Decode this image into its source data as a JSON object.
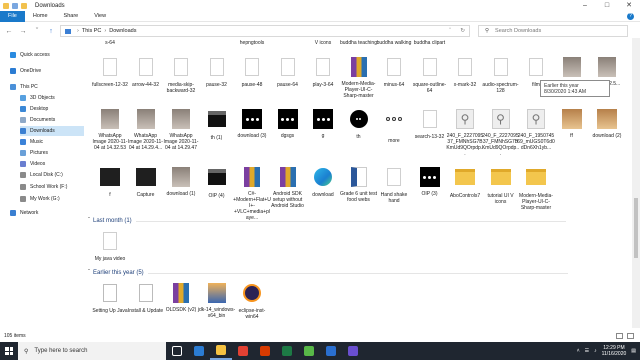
{
  "window": {
    "title": "Downloads"
  },
  "ribbon": {
    "tabs": [
      "File",
      "Home",
      "Share",
      "View"
    ]
  },
  "address": {
    "path": [
      "This PC",
      "Downloads"
    ],
    "search_placeholder": "Search Downloads"
  },
  "sidebar": {
    "items": [
      {
        "label": "Quick access",
        "color": "#2a8be0"
      },
      {
        "label": "OneDrive",
        "color": "#2b7cd3"
      },
      {
        "label": "This PC",
        "color": "#4a90d9"
      },
      {
        "label": "3D Objects",
        "color": "#57a0e0"
      },
      {
        "label": "Desktop",
        "color": "#3b88d6"
      },
      {
        "label": "Documents",
        "color": "#8ea9c8"
      },
      {
        "label": "Downloads",
        "color": "#3a7fd1"
      },
      {
        "label": "Music",
        "color": "#3a82d8"
      },
      {
        "label": "Pictures",
        "color": "#6aa0d8"
      },
      {
        "label": "Videos",
        "color": "#6a7ed0"
      },
      {
        "label": "Local Disk (C:)",
        "color": "#8a8a8a"
      },
      {
        "label": "School Work (F:)",
        "color": "#8a8a8a"
      },
      {
        "label": "My Work (G:)",
        "color": "#8a8a8a"
      },
      {
        "label": "Network",
        "color": "#3a7fd1"
      }
    ],
    "selected": "Downloads"
  },
  "files_top_partial": [
    {
      "label": "s-64"
    },
    {
      "label": ""
    },
    {
      "label": ""
    },
    {
      "label": ""
    },
    {
      "label": "hepngtools"
    },
    {
      "label": ""
    },
    {
      "label": "V icons"
    },
    {
      "label": "buddha teaching"
    },
    {
      "label": "buddha walking"
    },
    {
      "label": "buddha clipart"
    }
  ],
  "files_row1": [
    {
      "label": "fullscreen-12-32",
      "kind": "blank"
    },
    {
      "label": "arrow-44-32",
      "kind": "blank"
    },
    {
      "label": "media-skip-backward-32",
      "kind": "blank"
    },
    {
      "label": "pause-32",
      "kind": "blank"
    },
    {
      "label": "pause-48",
      "kind": "blank"
    },
    {
      "label": "pause-64",
      "kind": "blank"
    },
    {
      "label": "play-3-64",
      "kind": "blank"
    },
    {
      "label": "Modern-Media-Player-UI-C-Sharp-master",
      "kind": "rar"
    },
    {
      "label": "minus-64",
      "kind": "blank"
    },
    {
      "label": "square-outline-64",
      "kind": "blank"
    },
    {
      "label": "x-mark-32",
      "kind": "blank"
    },
    {
      "label": "audio-spectrum-128",
      "kind": "blank"
    },
    {
      "label": "film",
      "kind": "blank"
    },
    {
      "label": "",
      "kind": "photo"
    },
    {
      "label": "at 14.32.5...",
      "kind": "photo"
    }
  ],
  "files_row2": [
    {
      "label": "WhatsApp Image 2020-11-04 at 14.32.53",
      "kind": "photo"
    },
    {
      "label": "WhatsApp Image 2020-11-04 at 14.29.4...",
      "kind": "photo"
    },
    {
      "label": "WhatsApp Image 2020-11-04 at 14.29.47",
      "kind": "photo"
    },
    {
      "label": "th (1)",
      "kind": "clap"
    },
    {
      "label": "download (3)",
      "kind": "dots"
    },
    {
      "label": "dgsgs",
      "kind": "dots"
    },
    {
      "label": "g",
      "kind": "dots"
    },
    {
      "label": "th",
      "kind": "dots2"
    },
    {
      "label": "more",
      "kind": "more"
    },
    {
      "label": "search-13-32",
      "kind": "blank"
    },
    {
      "label": "240_F_222709537_FMNhSG7BKmUd9QOrpdp...",
      "kind": "search"
    },
    {
      "label": "240_F_222709537_FMNhSG7BKmUd9QOrpdp...",
      "kind": "search"
    },
    {
      "label": "240_F_195074569_mUGS0T6d0dDn6Xh1yb...",
      "kind": "search"
    },
    {
      "label": "ff",
      "kind": "cat"
    },
    {
      "label": "download (2)",
      "kind": "cat"
    }
  ],
  "files_row3": [
    {
      "label": "f",
      "kind": "dark"
    },
    {
      "label": "Capture",
      "kind": "dark"
    },
    {
      "label": "download (1)",
      "kind": "photo"
    },
    {
      "label": "OIP (4)",
      "kind": "clap"
    },
    {
      "label": "C#-+Modern+Flat+UI+-+VLC+media+playe...",
      "kind": "rar"
    },
    {
      "label": "Android SDK setup without Android Studio",
      "kind": "rar"
    },
    {
      "label": "download",
      "kind": "edge"
    },
    {
      "label": "Grade 6 unit test food webs",
      "kind": "word"
    },
    {
      "label": "Hand shake hand",
      "kind": "blank"
    },
    {
      "label": "OIP (3)",
      "kind": "dots"
    },
    {
      "label": "AboControls7",
      "kind": "folder"
    },
    {
      "label": "tutorial UI V icons",
      "kind": "folder"
    },
    {
      "label": "Modern-Media-Player-UI-C-Sharp-master",
      "kind": "folder"
    }
  ],
  "groups": {
    "last_month": "Last month (1)",
    "earlier_this_year": "Earlier this year (5)"
  },
  "files_last_month": [
    {
      "label": "My java video",
      "kind": "blank"
    }
  ],
  "files_earlier": [
    {
      "label": "Setting Up Java",
      "kind": "doc"
    },
    {
      "label": "Install & Update",
      "kind": "doc"
    },
    {
      "label": "OLDSDK (v2)",
      "kind": "rar"
    },
    {
      "label": "jdk-14_windows-x64_bin",
      "kind": "java"
    },
    {
      "label": "eclipse-inst-win64",
      "kind": "eclipse"
    }
  ],
  "tooltip": {
    "line1": "Earlier this year",
    "line2": "8/30/2020 1:43 AM"
  },
  "status": {
    "count": "105 items"
  },
  "taskbar": {
    "search_placeholder": "Type here to search",
    "time": "12:29 PM",
    "date": "11/16/2020",
    "apps": [
      {
        "name": "task-view",
        "color": "#ffffff"
      },
      {
        "name": "store",
        "color": "#2b7cd3"
      },
      {
        "name": "file-explorer",
        "color": "#f5c242"
      },
      {
        "name": "chrome",
        "color": "#e34133"
      },
      {
        "name": "office",
        "color": "#d83b01"
      },
      {
        "name": "excel",
        "color": "#1d7a45"
      },
      {
        "name": "camtasia",
        "color": "#58b848"
      },
      {
        "name": "app-blue",
        "color": "#2a6fd0"
      },
      {
        "name": "app-purple",
        "color": "#6a4fd0"
      }
    ]
  }
}
